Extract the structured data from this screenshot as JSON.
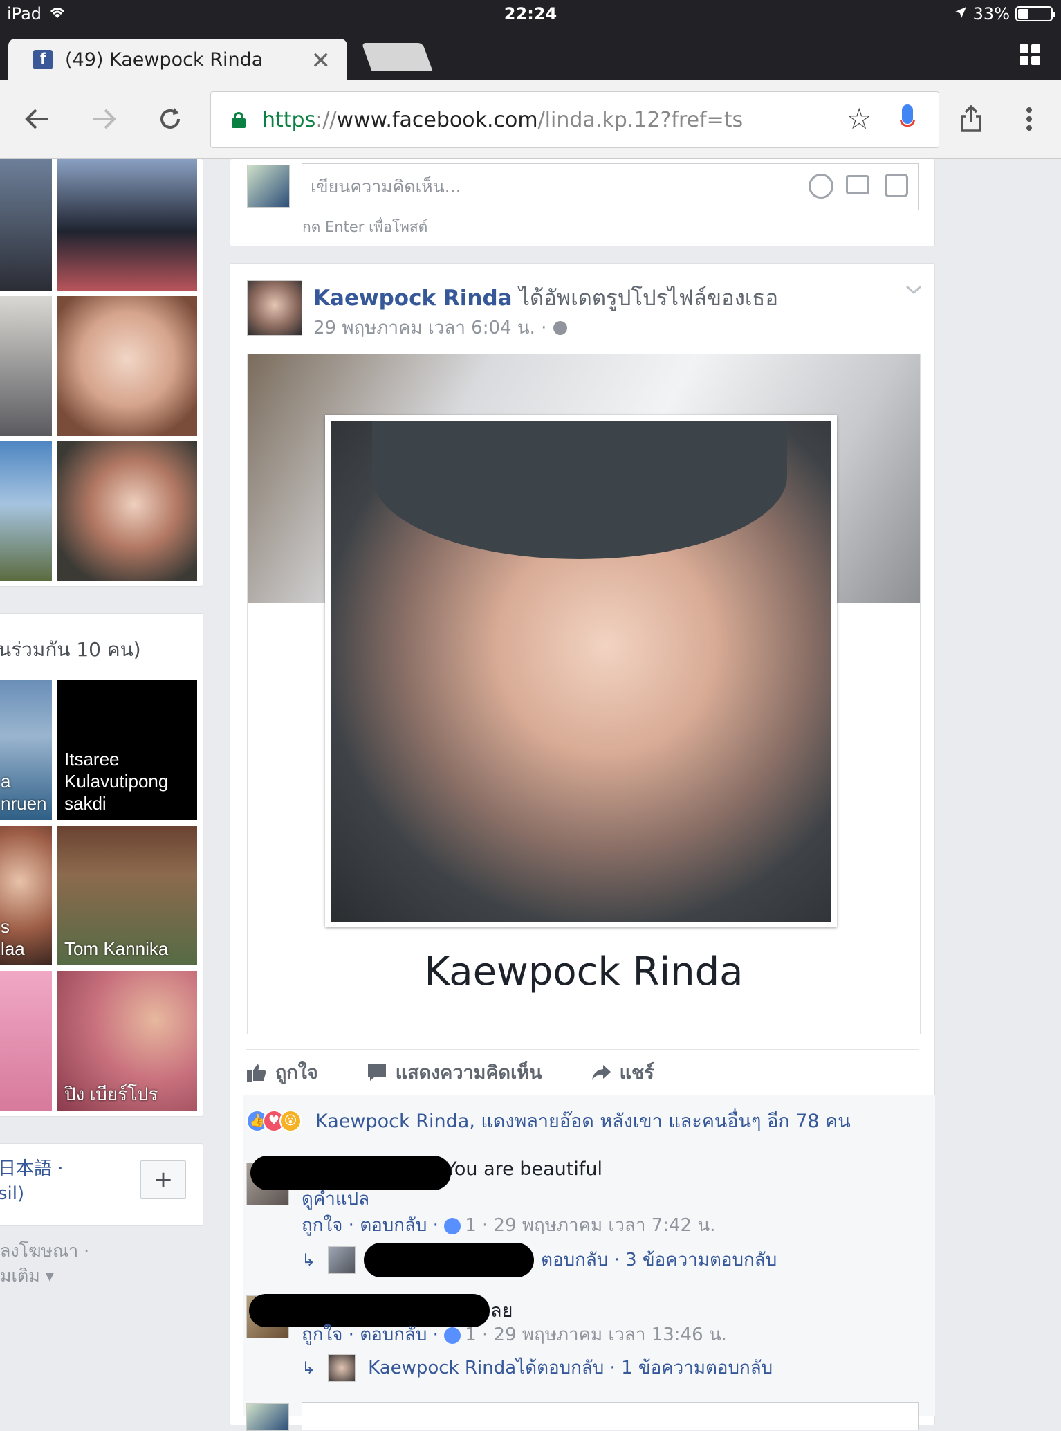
{
  "status_bar": {
    "device": "iPad",
    "time": "22:24",
    "battery": "33%",
    "battery_level": 0.33
  },
  "browser": {
    "tab_title": "(49) Kaewpock Rinda",
    "url": {
      "scheme": "https",
      "sep": "://",
      "host": "www.facebook.com",
      "path": "/linda.kp.12?fref=ts"
    }
  },
  "left_column": {
    "mutual_friends_title": "นร่วมกัน 10 คน)",
    "friends": [
      {
        "name": "a\nnruen"
      },
      {
        "name": "Itsaree\nKulavutipong\nsakdi"
      },
      {
        "name": "s\nlaa"
      },
      {
        "name": "Tom Kannika"
      },
      {
        "name": ""
      },
      {
        "name": "ปิง เบียร์โปร"
      }
    ],
    "languages": "日本語 ·\nsil)",
    "add_button": "+",
    "footer": "ลงโฆษณา ·\nมเติม ▾"
  },
  "comment_box_top": {
    "placeholder": "เขียนความคิดเห็น...",
    "hint": "กด Enter เพื่อโพสต์"
  },
  "post": {
    "author": "Kaewpock Rinda",
    "action_text": " ได้อัพเดตรูปโปรไฟล์ของเธอ",
    "timestamp": "29 พฤษภาคม เวลา 6:04 น. ·",
    "profile_name": "Kaewpock Rinda",
    "actions": {
      "like": "ถูกใจ",
      "comment": "แสดงความคิดเห็น",
      "share": "แชร์"
    },
    "reactions_summary": "Kaewpock Rinda, แดงพลายอ๊อด หลังเขา และคนอื่นๆ อีก 78 คน"
  },
  "comments": [
    {
      "text": "You are beautiful",
      "translate": "ดูคำแปล",
      "meta_like": "ถูกใจ · ตอบกลับ · ",
      "meta_likes_count": "1",
      "meta_time": " · 29 พฤษภาคม เวลา 7:42 น.",
      "reply_summary": "ตอบกลับ · 3 ข้อความตอบกลับ"
    },
    {
      "text": "ยเลย",
      "meta_like": "ถูกใจ · ตอบกลับ · ",
      "meta_likes_count": "1",
      "meta_time": " · 29 พฤษภาคม เวลา 13:46 น.",
      "reply_author": "Kaewpock Rinda",
      "reply_summary": " ได้ตอบกลับ · 1 ข้อความตอบกลับ"
    }
  ]
}
